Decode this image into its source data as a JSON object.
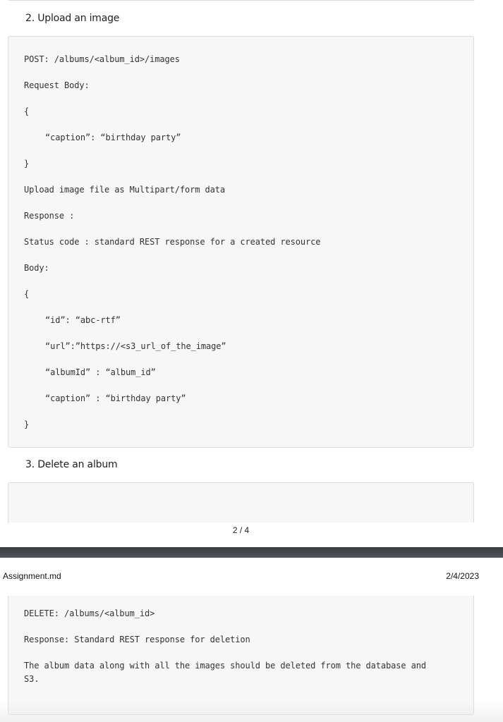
{
  "section2": {
    "heading": "2. Upload an image",
    "lines": [
      "POST: /albums/<album_id>/images",
      "Request Body:",
      "{",
      "“caption”: “birthday party”",
      "}",
      "Upload image file as Multipart/form data",
      "Response :",
      "Status code : standard REST response for a created resource",
      "Body:",
      "{",
      "“id”: “abc-rtf”",
      "“url”:”https://<s3_url_of_the_image”",
      "“albumId” : “album_id”",
      "“caption” : “birthday party”",
      "}"
    ]
  },
  "section3": {
    "heading": "3. Delete an album",
    "lines": [
      "DELETE: /albums/<album_id>",
      "Response: Standard REST response for deletion",
      "The album data along with all the images should be deleted from the database and",
      "S3."
    ]
  },
  "page": {
    "number": "2 / 4",
    "header_title": "Assignment.md",
    "header_date": "2/4/2023"
  }
}
